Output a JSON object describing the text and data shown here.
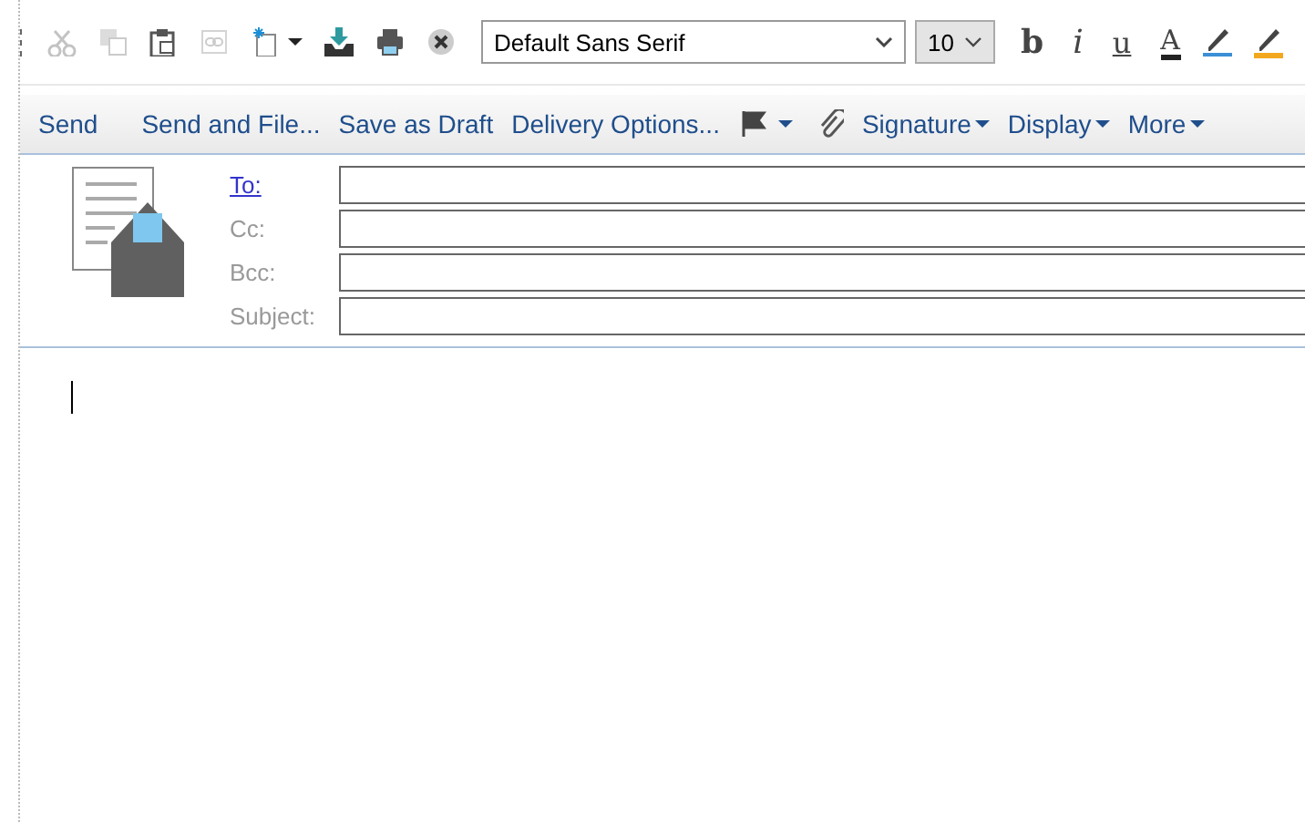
{
  "toolbar": {
    "icons": [
      {
        "kind": "cut",
        "disabled": true
      },
      {
        "kind": "copy",
        "disabled": true
      },
      {
        "kind": "paste",
        "disabled": false
      },
      {
        "kind": "link",
        "disabled": true
      },
      {
        "kind": "new",
        "disabled": false
      },
      {
        "kind": "save",
        "disabled": false
      },
      {
        "kind": "print",
        "disabled": false
      },
      {
        "kind": "cancel",
        "disabled": false
      }
    ],
    "font": {
      "value": "Default Sans Serif"
    },
    "size": {
      "value": "10"
    },
    "format_buttons": [
      {
        "kind": "bold",
        "label": "b"
      },
      {
        "kind": "italic",
        "label": "i"
      },
      {
        "kind": "underline",
        "label": "u"
      },
      {
        "kind": "color",
        "label": "A"
      },
      {
        "kind": "pen"
      },
      {
        "kind": "highlight"
      }
    ]
  },
  "actions": [
    {
      "kind": "text",
      "label": "Send"
    },
    {
      "kind": "text",
      "label": "Send and File..."
    },
    {
      "kind": "text",
      "label": "Save as Draft"
    },
    {
      "kind": "text",
      "label": "Delivery Options..."
    },
    {
      "kind": "flag"
    },
    {
      "kind": "attach"
    },
    {
      "kind": "menu",
      "label": "Signature"
    },
    {
      "kind": "menu",
      "label": "Display"
    },
    {
      "kind": "menu",
      "label": "More"
    }
  ],
  "fields": [
    {
      "kind": "link",
      "label": "To:"
    },
    {
      "kind": "label",
      "label": "Cc:"
    },
    {
      "kind": "label",
      "label": "Bcc:"
    },
    {
      "kind": "label",
      "label": "Subject:"
    }
  ]
}
